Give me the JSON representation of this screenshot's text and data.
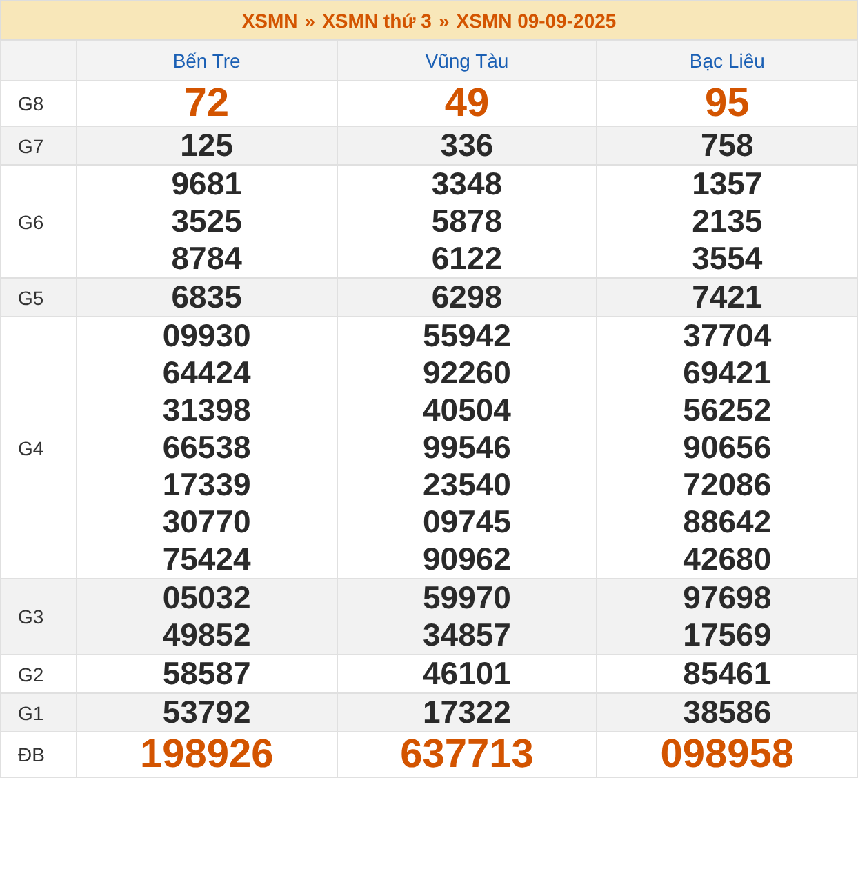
{
  "breadcrumb": [
    {
      "label": "XSMN"
    },
    {
      "label": "XSMN thứ 3"
    },
    {
      "label": "XSMN 09-09-2025"
    }
  ],
  "breadcrumb_separator": "»",
  "provinces": [
    "Bến Tre",
    "Vũng Tàu",
    "Bạc Liêu"
  ],
  "prizes": [
    {
      "label": "G8",
      "highlight": true,
      "results": [
        [
          "72"
        ],
        [
          "49"
        ],
        [
          "95"
        ]
      ]
    },
    {
      "label": "G7",
      "highlight": false,
      "results": [
        [
          "125"
        ],
        [
          "336"
        ],
        [
          "758"
        ]
      ]
    },
    {
      "label": "G6",
      "highlight": false,
      "results": [
        [
          "9681",
          "3525",
          "8784"
        ],
        [
          "3348",
          "5878",
          "6122"
        ],
        [
          "1357",
          "2135",
          "3554"
        ]
      ]
    },
    {
      "label": "G5",
      "highlight": false,
      "results": [
        [
          "6835"
        ],
        [
          "6298"
        ],
        [
          "7421"
        ]
      ]
    },
    {
      "label": "G4",
      "highlight": false,
      "results": [
        [
          "09930",
          "64424",
          "31398",
          "66538",
          "17339",
          "30770",
          "75424"
        ],
        [
          "55942",
          "92260",
          "40504",
          "99546",
          "23540",
          "09745",
          "90962"
        ],
        [
          "37704",
          "69421",
          "56252",
          "90656",
          "72086",
          "88642",
          "42680"
        ]
      ]
    },
    {
      "label": "G3",
      "highlight": false,
      "results": [
        [
          "05032",
          "49852"
        ],
        [
          "59970",
          "34857"
        ],
        [
          "97698",
          "17569"
        ]
      ]
    },
    {
      "label": "G2",
      "highlight": false,
      "results": [
        [
          "58587"
        ],
        [
          "46101"
        ],
        [
          "85461"
        ]
      ]
    },
    {
      "label": "G1",
      "highlight": false,
      "results": [
        [
          "53792"
        ],
        [
          "17322"
        ],
        [
          "38586"
        ]
      ]
    },
    {
      "label": "ĐB",
      "highlight": true,
      "results": [
        [
          "198926"
        ],
        [
          "637713"
        ],
        [
          "098958"
        ]
      ]
    }
  ]
}
